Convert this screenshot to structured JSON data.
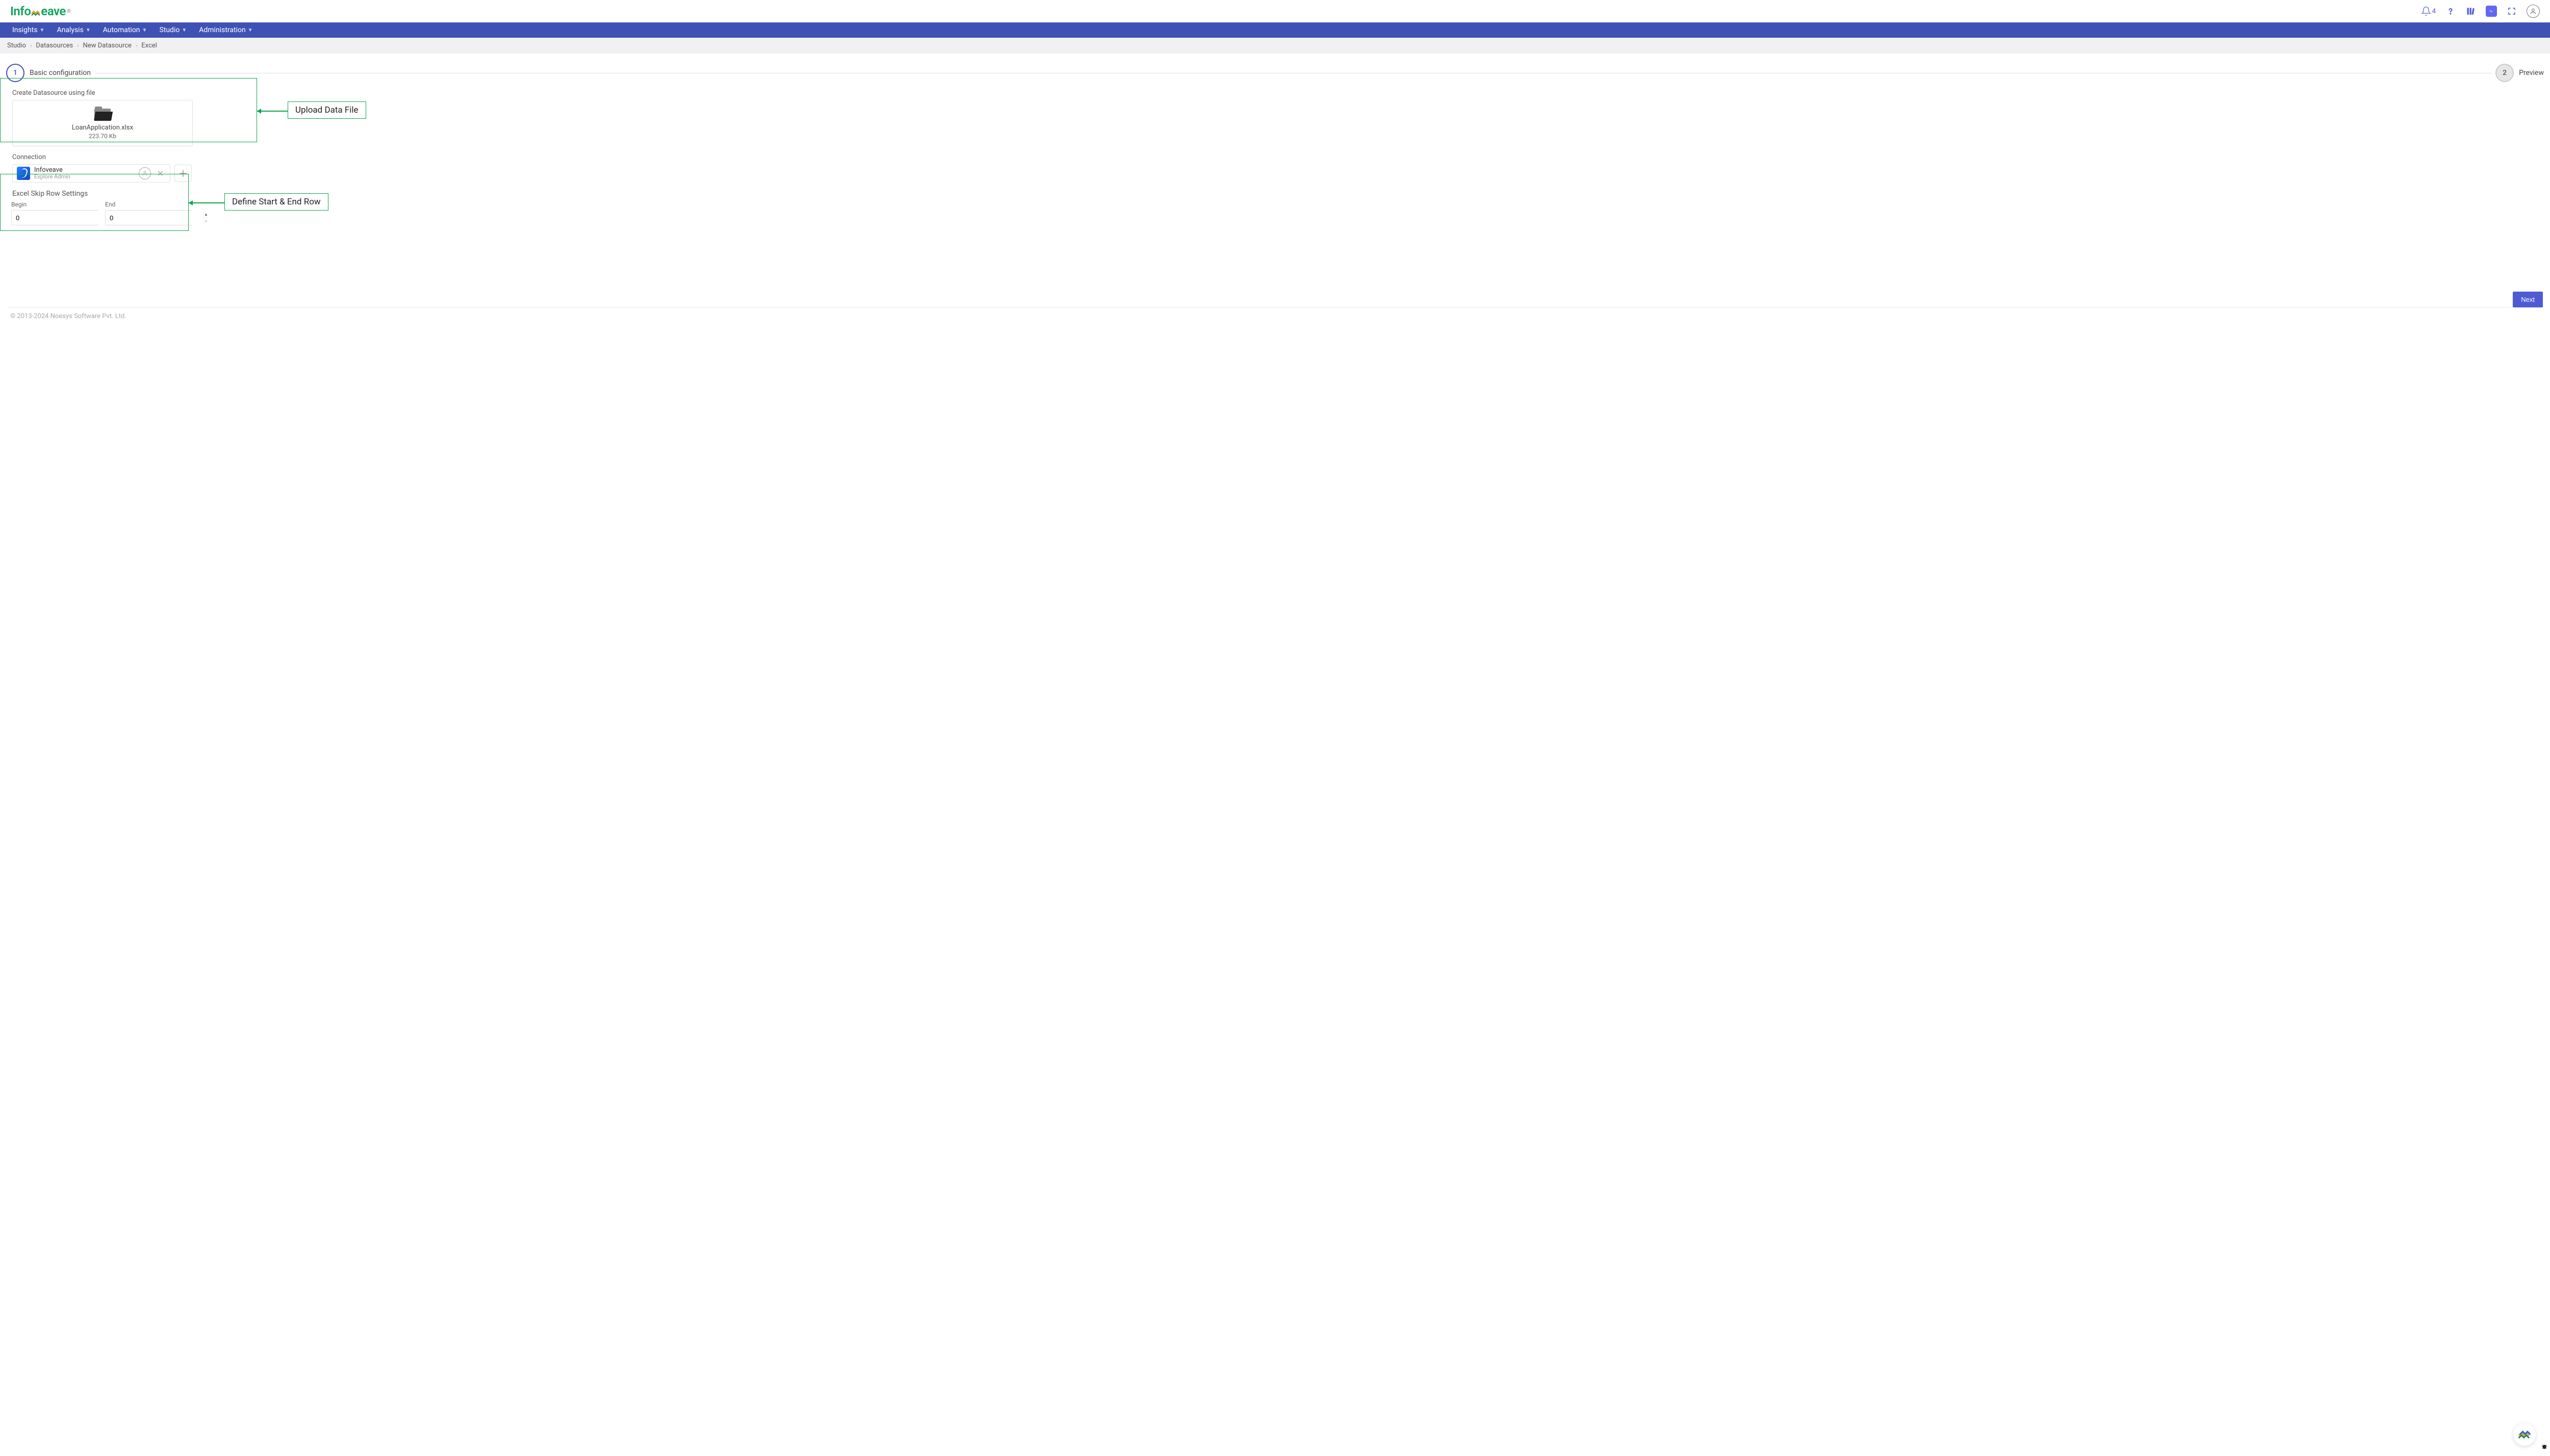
{
  "header": {
    "logo_parts": {
      "a": "Info",
      "b": "eave"
    },
    "notification_count": "4"
  },
  "nav": {
    "items": [
      "Insights",
      "Analysis",
      "Automation",
      "Studio",
      "Administration"
    ]
  },
  "breadcrumb": {
    "items": [
      "Studio",
      "Datasources",
      "New Datasource",
      "Excel"
    ]
  },
  "stepper": {
    "step1_num": "1",
    "step1_label": "Basic configuration",
    "step2_num": "2",
    "step2_label": "Preview"
  },
  "upload": {
    "section_title": "Create Datasource using file",
    "file_name": "LoanApplication.xlsx",
    "file_size": "223.70 Kb"
  },
  "connection": {
    "label": "Connection",
    "name": "Infoveave",
    "sub": "Explore Admin"
  },
  "skip_rows": {
    "title": "Excel Skip Row Settings",
    "begin_label": "Begin",
    "begin_value": "0",
    "end_label": "End",
    "end_value": "0"
  },
  "annotations": {
    "upload": "Upload Data File",
    "rows": "Define Start & End Row"
  },
  "next_label": "Next",
  "footer": "© 2013-2024 Noesys Software Pvt. Ltd."
}
